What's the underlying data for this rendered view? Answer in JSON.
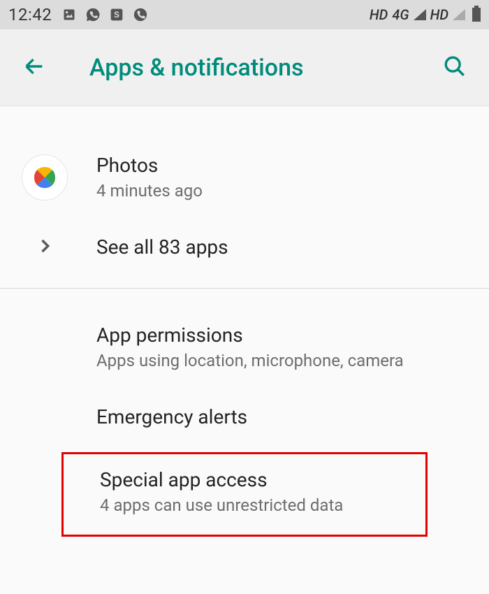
{
  "status_bar": {
    "time": "12:42",
    "indicator1": "HD",
    "network1": "4G",
    "indicator2": "HD"
  },
  "app_bar": {
    "title": "Apps & notifications"
  },
  "photos_item": {
    "label": "Photos",
    "subtitle": "4 minutes ago"
  },
  "see_all": {
    "label": "See all 83 apps"
  },
  "app_permissions": {
    "label": "App permissions",
    "subtitle": "Apps using location, microphone, camera"
  },
  "emergency_alerts": {
    "label": "Emergency alerts"
  },
  "special_access": {
    "label": "Special app access",
    "subtitle": "4 apps can use unrestricted data"
  }
}
